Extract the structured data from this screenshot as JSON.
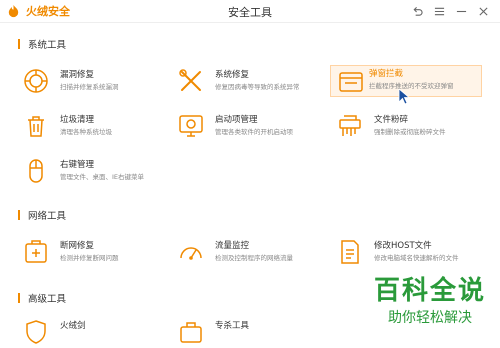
{
  "app": {
    "name": "火绒安全",
    "window_title": "安全工具"
  },
  "colors": {
    "accent": "#f08a00",
    "watermark": "#2a9a3a"
  },
  "sections": [
    {
      "title": "系统工具"
    },
    {
      "title": "网络工具"
    },
    {
      "title": "高级工具"
    }
  ],
  "tools": {
    "system": [
      {
        "name": "漏洞修复",
        "desc": "扫描并修复系统漏洞",
        "icon": "shield-repair-icon"
      },
      {
        "name": "系统修复",
        "desc": "修复因病毒等导致的系统异常",
        "icon": "wrench-screwdriver-icon"
      },
      {
        "name": "弹窗拦截",
        "desc": "拦截程序推送的不受欢迎弹窗",
        "icon": "popup-window-icon"
      },
      {
        "name": "垃圾清理",
        "desc": "清理各种系统垃圾",
        "icon": "trash-icon"
      },
      {
        "name": "启动项管理",
        "desc": "管理各类软件的开机启动项",
        "icon": "startup-monitor-icon"
      },
      {
        "name": "文件粉碎",
        "desc": "强制删除或彻底粉碎文件",
        "icon": "shredder-icon"
      },
      {
        "name": "右键管理",
        "desc": "管理文件、桌面、IE右键菜单",
        "icon": "mouse-icon"
      }
    ],
    "network": [
      {
        "name": "断网修复",
        "desc": "检测并修复断网问题",
        "icon": "network-repair-icon"
      },
      {
        "name": "流量监控",
        "desc": "检测及控制程序的网络流量",
        "icon": "traffic-gauge-icon"
      },
      {
        "name": "修改HOST文件",
        "desc": "修改电脑域名快速解析的文件",
        "icon": "document-edit-icon"
      }
    ],
    "advanced": [
      {
        "name": "火绒剑",
        "desc": "",
        "icon": "sword-shield-icon"
      },
      {
        "name": "专杀工具",
        "desc": "",
        "icon": "toolbox-icon"
      }
    ]
  },
  "watermark": {
    "big": "百科全说",
    "small": "助你轻松解决"
  }
}
